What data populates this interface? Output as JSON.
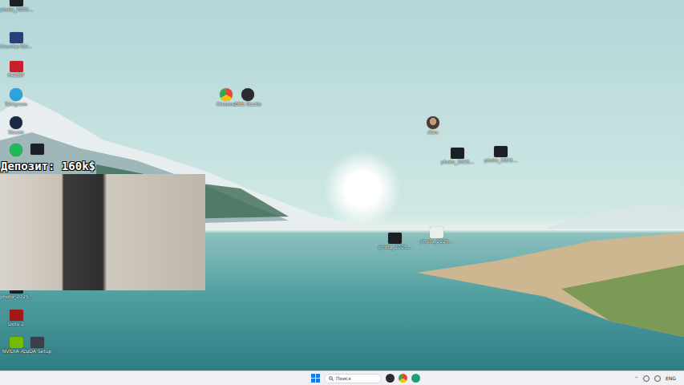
{
  "overlay": {
    "deposit": "Депозит: 160k$"
  },
  "desktop_icons": [
    {
      "kind": "photo",
      "label": "photo_2025..."
    },
    {
      "kind": "cs",
      "label": "Counter-Str..."
    },
    {
      "kind": "faceit",
      "label": "FACEIT"
    },
    {
      "kind": "telegram",
      "label": "Telegram"
    },
    {
      "kind": "steam",
      "label": "Steam"
    },
    {
      "kind": "green"
    },
    {
      "kind": "photo"
    },
    {
      "kind": "chrome",
      "label": "Chrome"
    },
    {
      "kind": "obs",
      "label": "OBS Studio"
    },
    {
      "kind": "avatar",
      "label": "Alex"
    },
    {
      "kind": "photo",
      "label": "photo_2025..."
    },
    {
      "kind": "photo",
      "label": "photo_2025..."
    },
    {
      "kind": "photo",
      "label": "photo_2025..."
    },
    {
      "kind": "doc",
      "label": "photo_2025..."
    },
    {
      "kind": "photo",
      "label": "photo_2025..."
    },
    {
      "kind": "dota",
      "label": "Dota 2"
    },
    {
      "kind": "nvidia",
      "label": "NVIDIA App"
    },
    {
      "kind": "generic",
      "label": "CUDA Setup"
    }
  ],
  "taskbar": {
    "search_placeholder": "Поиск",
    "language": "ENG"
  }
}
